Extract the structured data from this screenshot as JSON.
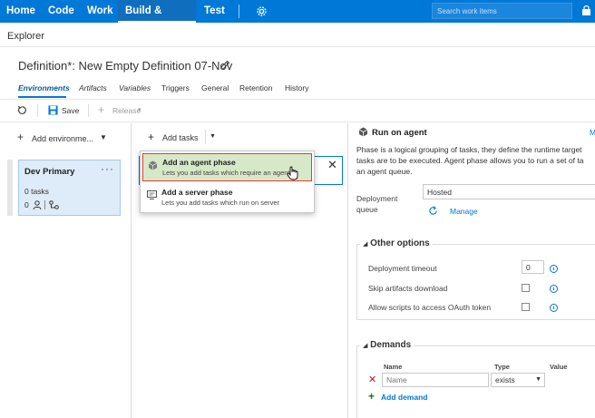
{
  "topnav": {
    "items": [
      "Home",
      "Code",
      "Work",
      "Build & Release",
      "Test"
    ],
    "active": "Build & Release",
    "search_placeholder": "Search work items",
    "settings_icon": "gear-icon",
    "bag_icon": "shopping-bag-icon"
  },
  "explorer": {
    "label": "Explorer"
  },
  "definition": {
    "title": "Definition*: New Empty Definition 07-Nov",
    "edit_icon": "pencil-icon"
  },
  "tabs": [
    "Environments",
    "Artifacts",
    "Variables",
    "Triggers",
    "General",
    "Retention",
    "History"
  ],
  "active_tab": "Environments",
  "toolbar": {
    "save_label": "Save",
    "release_label": "Release"
  },
  "left": {
    "add_environment_label": "Add environme...",
    "environment": {
      "name": "Dev Primary",
      "menu": "···",
      "tasks": "0 tasks",
      "approvers": "0"
    }
  },
  "middle": {
    "add_tasks_label": "Add tasks",
    "menu": [
      {
        "title": "Add an agent phase",
        "subtitle": "Lets you add tasks which require an agent",
        "icon": "agent-icon",
        "highlighted": true
      },
      {
        "title": "Add a server phase",
        "subtitle": "Lets you add tasks which run on server",
        "icon": "server-icon",
        "highlighted": false
      }
    ],
    "close_icon": "close-icon"
  },
  "right": {
    "title": "Run on agent",
    "more_link": "M",
    "description": "Phase is a logical grouping of tasks, they define the runtime target\ntasks are to be executed. Agent phase allows you to run a set of ta\nan agent queue.",
    "deployment_queue_label": "Deployment\nqueue",
    "deployment_queue_value": "Hosted",
    "manage_label": "Manage",
    "other_options": {
      "title": "Other options",
      "timeout_label": "Deployment timeout",
      "timeout_value": "0",
      "skip_label": "Skip artifacts download",
      "oauth_label": "Allow scripts to access OAuth token"
    },
    "demands": {
      "title": "Demands",
      "col_name": "Name",
      "col_type": "Type",
      "col_value": "Value",
      "name_placeholder": "Name",
      "type_value": "exists",
      "add_label": "Add demand"
    }
  },
  "colors": {
    "nav_blue": "#0078d7",
    "card_blue": "#deecf9",
    "highlight_green": "#d7e8c8",
    "highlight_border": "#e03c31",
    "remove_red": "#c50f1f",
    "add_green": "#107c10"
  }
}
